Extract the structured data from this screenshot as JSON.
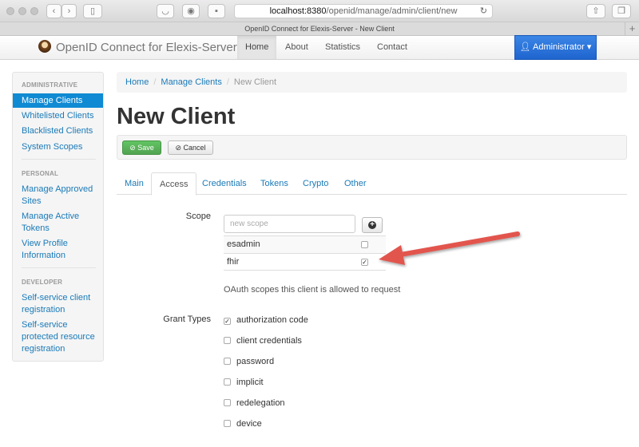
{
  "browser": {
    "url_host": "localhost:8380",
    "url_path": "/openid/manage/admin/client/new",
    "tab_title": "OpenID Connect for Elexis-Server - New Client"
  },
  "navbar": {
    "brand": "OpenID Connect for Elexis-Server",
    "items": [
      "Home",
      "About",
      "Statistics",
      "Contact"
    ],
    "user_menu": "Administrator"
  },
  "sidebar": {
    "sections": [
      {
        "header": "ADMINISTRATIVE",
        "links": [
          "Manage Clients",
          "Whitelisted Clients",
          "Blacklisted Clients",
          "System Scopes"
        ]
      },
      {
        "header": "PERSONAL",
        "links": [
          "Manage Approved Sites",
          "Manage Active Tokens",
          "View Profile Information"
        ]
      },
      {
        "header": "DEVELOPER",
        "links": [
          "Self-service client registration",
          "Self-service protected resource registration"
        ]
      }
    ]
  },
  "breadcrumb": [
    "Home",
    "Manage Clients",
    "New Client"
  ],
  "page_title": "New Client",
  "actions": {
    "save": "Save",
    "cancel": "Cancel"
  },
  "tabs": [
    "Main",
    "Access",
    "Credentials",
    "Tokens",
    "Crypto",
    "Other"
  ],
  "form": {
    "scope_label": "Scope",
    "scope_placeholder": "new scope",
    "scopes": [
      {
        "name": "esadmin",
        "checked": false
      },
      {
        "name": "fhir",
        "checked": true
      }
    ],
    "scope_help": "OAuth scopes this client is allowed to request",
    "grant_label": "Grant Types",
    "grant_types": [
      {
        "name": "authorization code",
        "checked": true
      },
      {
        "name": "client credentials",
        "checked": false
      },
      {
        "name": "password",
        "checked": false
      },
      {
        "name": "implicit",
        "checked": false
      },
      {
        "name": "redelegation",
        "checked": false
      },
      {
        "name": "device",
        "checked": false
      }
    ]
  },
  "colors": {
    "primary": "#2a6fd6",
    "sidebar_active": "#0f8ad3",
    "link": "#1a7ab8",
    "save_green": "#51a351",
    "annotation_arrow": "#e2544d"
  }
}
